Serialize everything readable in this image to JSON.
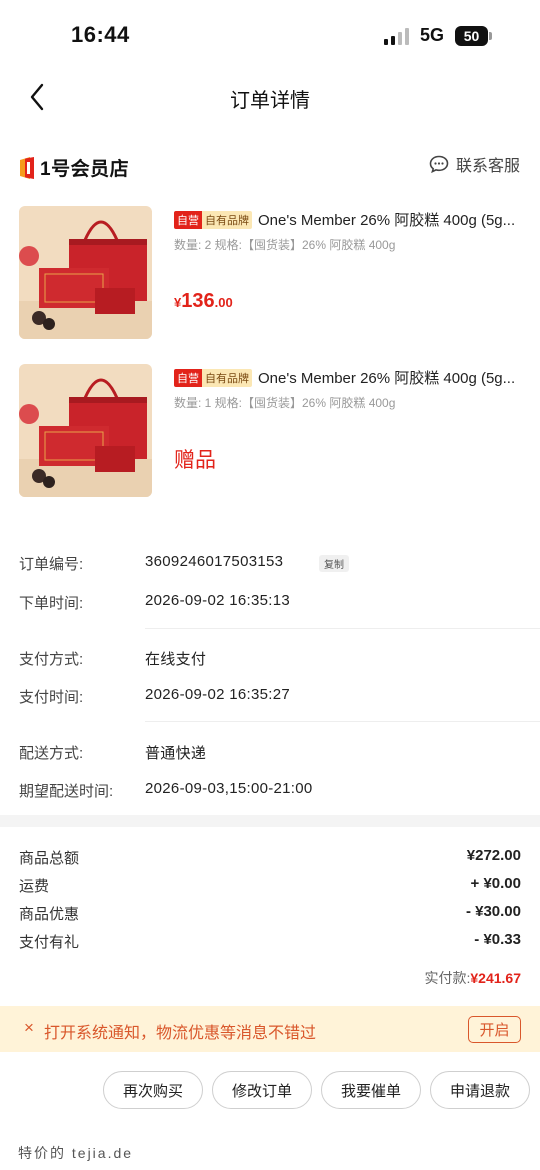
{
  "status_bar": {
    "time": "16:44",
    "network": "5G",
    "battery": "50"
  },
  "nav": {
    "title": "订单详情"
  },
  "store": {
    "name": "1号会员店",
    "logo_mark": "1",
    "service_label": "联系客服"
  },
  "products": [
    {
      "tag_self": "自营",
      "tag_brand": "自有品牌",
      "title": "One's Member 26% 阿胶糕 400g (5g...",
      "spec": "数量: 2 规格:【囤货装】26% 阿胶糕 400g",
      "price_symbol": "¥",
      "price_int": "136",
      "price_dec": ".00"
    },
    {
      "tag_self": "自营",
      "tag_brand": "自有品牌",
      "title": "One's Member 26% 阿胶糕 400g (5g...",
      "spec": "数量: 1 规格:【囤货装】26% 阿胶糕 400g",
      "gift_label": "赠品"
    }
  ],
  "order_info": {
    "order_no_label": "订单编号:",
    "order_no": "3609246017503153",
    "copy_label": "复制",
    "order_time_label": "下单时间:",
    "order_time": "2026-09-02 16:35:13",
    "pay_method_label": "支付方式:",
    "pay_method": "在线支付",
    "pay_time_label": "支付时间:",
    "pay_time": "2026-09-02 16:35:27",
    "delivery_method_label": "配送方式:",
    "delivery_method": "普通快递",
    "expected_delivery_label": "期望配送时间:",
    "expected_delivery": "2026-09-03,15:00-21:00"
  },
  "summary": {
    "goods_total_label": "商品总额",
    "goods_total": "¥272.00",
    "shipping_label": "运费",
    "shipping": "+ ¥0.00",
    "discount_label": "商品优惠",
    "discount": "- ¥30.00",
    "pay_gift_label": "支付有礼",
    "pay_gift": "- ¥0.33",
    "paid_label": "实付款:",
    "paid": "¥241.67"
  },
  "notification": {
    "close": "×",
    "text": "打开系统通知，物流优惠等消息不错过",
    "open_label": "开启"
  },
  "actions": [
    "再次购买",
    "修改订单",
    "我要催单",
    "申请退款"
  ],
  "watermark": "特价的 tejia.de",
  "colors": {
    "accent": "#e2231a",
    "notify_bg": "#fff3d8",
    "notify_text": "#d9572b"
  }
}
